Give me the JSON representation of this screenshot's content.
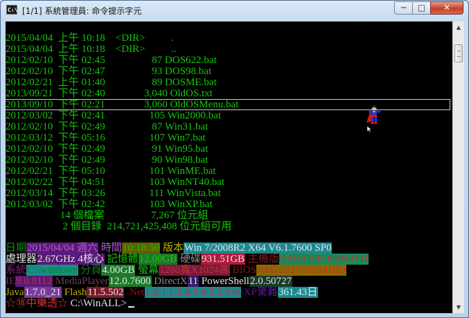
{
  "window": {
    "title": "[1/1] 系統管理員: 命令提示字元",
    "icon_text": "C:\\",
    "minimize": "─",
    "maximize": "□",
    "close": "✕"
  },
  "listing": [
    {
      "date": "2015/04/04",
      "ampm": "上午",
      "time": "10:18",
      "size": "<DIR>",
      "name": "."
    },
    {
      "date": "2015/04/04",
      "ampm": "上午",
      "time": "10:18",
      "size": "<DIR>",
      "name": ".."
    },
    {
      "date": "2012/02/10",
      "ampm": "下午",
      "time": "02:45",
      "size": "87",
      "name": "DOS622.bat"
    },
    {
      "date": "2012/02/10",
      "ampm": "下午",
      "time": "02:47",
      "size": "93",
      "name": "DOS98.bat"
    },
    {
      "date": "2012/02/21",
      "ampm": "上午",
      "time": "01:40",
      "size": "89",
      "name": "DOSME.bat"
    },
    {
      "date": "2013/09/21",
      "ampm": "下午",
      "time": "02:40",
      "size": "3,040",
      "name": "OldOS.txt"
    },
    {
      "date": "2013/09/10",
      "ampm": "下午",
      "time": "02:21",
      "size": "3,060",
      "name": "OldOSMenu.bat"
    },
    {
      "date": "2012/03/02",
      "ampm": "下午",
      "time": "02:41",
      "size": "105",
      "name": "Win2000.bat"
    },
    {
      "date": "2012/02/10",
      "ampm": "下午",
      "time": "02:49",
      "size": "87",
      "name": "Win31.bat"
    },
    {
      "date": "2012/03/12",
      "ampm": "下午",
      "time": "05:16",
      "size": "107",
      "name": "Win7.bat"
    },
    {
      "date": "2012/02/10",
      "ampm": "下午",
      "time": "02:49",
      "size": "91",
      "name": "Win95.bat"
    },
    {
      "date": "2012/02/10",
      "ampm": "下午",
      "time": "02:49",
      "size": "90",
      "name": "Win98.bat"
    },
    {
      "date": "2012/02/21",
      "ampm": "下午",
      "time": "05:10",
      "size": "101",
      "name": "WinME.bat"
    },
    {
      "date": "2012/02/22",
      "ampm": "下午",
      "time": "04:51",
      "size": "103",
      "name": "WinNT40.bat"
    },
    {
      "date": "2012/03/14",
      "ampm": "下午",
      "time": "03:26",
      "size": "111",
      "name": "WinVista.bat"
    },
    {
      "date": "2012/03/02",
      "ampm": "下午",
      "time": "02:42",
      "size": "103",
      "name": "WinXP.bat"
    }
  ],
  "summary": {
    "files_count": "14",
    "files_label": "個檔案",
    "files_bytes": "7,267",
    "files_unit": "位元組",
    "dirs_count": "2",
    "dirs_label": "個目錄",
    "free_bytes": "214,721,425,408",
    "free_unit": "位元組可用"
  },
  "status_lines": [
    [
      {
        "text": "日期",
        "fg": "#0c8a0c",
        "bg": ""
      },
      {
        "text": "2015/04/04 週六",
        "fg": "#b060d0",
        "bg": "#5a1a7a"
      },
      {
        "text": " ",
        "fg": "#e6e6e6",
        "bg": ""
      },
      {
        "text": "時間",
        "fg": "#b060d0",
        "bg": ""
      },
      {
        "text": "10:18:50",
        "fg": "#16c60c",
        "bg": "#6a5a00"
      },
      {
        "text": " ",
        "fg": "#e6e6e6",
        "bg": ""
      },
      {
        "text": "版本",
        "fg": "#c0b000",
        "bg": ""
      },
      {
        "text": "Win 7/2008R2 X64 V6.1.7600 SP0",
        "fg": "#e6e6e6",
        "bg": "#1a8a90"
      }
    ],
    [
      {
        "text": "處理器",
        "fg": "#e6e6e6",
        "bg": ""
      },
      {
        "text": "2.67GHz 4核心",
        "fg": "#e6e6e6",
        "bg": "#5a1a7a"
      },
      {
        "text": " ",
        "fg": "#e6e6e6",
        "bg": ""
      },
      {
        "text": "記憶體",
        "fg": "#16c60c",
        "bg": ""
      },
      {
        "text": "12.00GB",
        "fg": "#16c60c",
        "bg": "#1a7a2a"
      },
      {
        "text": " ",
        "fg": "#e6e6e6",
        "bg": ""
      },
      {
        "text": "硬碟",
        "fg": "#8a8a8a",
        "bg": ""
      },
      {
        "text": "931.51GB",
        "fg": "#e6e6e6",
        "bg": "#b01a3a"
      },
      {
        "text": " ",
        "fg": "#e6e6e6",
        "bg": ""
      },
      {
        "text": "主機版",
        "fg": "#8a1a1a",
        "bg": ""
      },
      {
        "text": "ASUSTeK P5P43TD",
        "fg": "#c03030",
        "bg": "#1a8a5a"
      }
    ],
    [
      {
        "text": "系統",
        "fg": "#8a1a8a",
        "bg": ""
      },
      {
        "text": "C:\\windows",
        "fg": "#0c8a0c",
        "bg": "#1a8a90"
      },
      {
        "text": " ",
        "fg": "#e6e6e6",
        "bg": ""
      },
      {
        "text": "分頁",
        "fg": "#1a7a2a",
        "bg": ""
      },
      {
        "text": "4.00GB",
        "fg": "#e6e6e6",
        "bg": "#1a7a2a"
      },
      {
        "text": " ",
        "fg": "#e6e6e6",
        "bg": ""
      },
      {
        "text": "螢幕",
        "fg": "#16c60c",
        "bg": ""
      },
      {
        "text": "1280寬X1024高",
        "fg": "#c03030",
        "bg": "#7a1a3a"
      },
      {
        "text": " ",
        "fg": "#e6e6e6",
        "bg": ""
      },
      {
        "text": "BIOS",
        "fg": "#8a1a1a",
        "bg": ""
      },
      {
        "text": "AMI 2010Y05M18D",
        "fg": "#c03030",
        "bg": "#8a6a00"
      }
    ],
    [
      {
        "text": "IE",
        "fg": "#8a1a8a",
        "bg": ""
      },
      {
        "text": "9.0.8112",
        "fg": "#c03030",
        "bg": "#5a1a7a"
      },
      {
        "text": " ",
        "fg": "#e6e6e6",
        "bg": ""
      },
      {
        "text": "MediaPlayer",
        "fg": "#7a3a5a",
        "bg": ""
      },
      {
        "text": "12.0.7600",
        "fg": "#e6e6e6",
        "bg": "#1a7a2a"
      },
      {
        "text": " ",
        "fg": "#e6e6e6",
        "bg": ""
      },
      {
        "text": "DirectX",
        "fg": "#8a8a8a",
        "bg": ""
      },
      {
        "text": "11",
        "fg": "#e6e6e6",
        "bg": "#3a1a6a"
      },
      {
        "text": " ",
        "fg": "#e6e6e6",
        "bg": ""
      },
      {
        "text": "PowerShell",
        "fg": "#e6e6e6",
        "bg": ""
      },
      {
        "text": "2.0.50727",
        "fg": "#e6e6e6",
        "bg": "#1a3a2a"
      }
    ],
    [
      {
        "text": "Java",
        "fg": "#c0b000",
        "bg": ""
      },
      {
        "text": "1.7.0_21",
        "fg": "#e6e6e6",
        "bg": "#7a3a9a"
      },
      {
        "text": " ",
        "fg": "#e6e6e6",
        "bg": ""
      },
      {
        "text": "Flash",
        "fg": "#c0b000",
        "bg": ""
      },
      {
        "text": "11.5.502",
        "fg": "#e6e6e6",
        "bg": "#7a1a2a"
      },
      {
        "text": " ",
        "fg": "#e6e6e6",
        "bg": ""
      },
      {
        "text": ".Net",
        "fg": "#8a1a1a",
        "bg": ""
      },
      {
        "text": "1.0/1.1/2.0/3.0/3.5/4.0/",
        "fg": "#c03030",
        "bg": "#1a8a90"
      },
      {
        "text": " ",
        "fg": "#e6e6e6",
        "bg": ""
      },
      {
        "text": "XP驚難",
        "fg": "#5a1a9a",
        "bg": ""
      },
      {
        "text": "361.43日",
        "fg": "#e6e6e6",
        "bg": "#1a8a90"
      }
    ]
  ],
  "prompt": {
    "brand": "☆⑱中樂透☆",
    "path": " C:\\WinALL>"
  },
  "colors": {
    "console_bg": "#000000",
    "console_fg": "#16c60c",
    "text_white": "#e6e6e6",
    "brand_red": "#e03030"
  }
}
